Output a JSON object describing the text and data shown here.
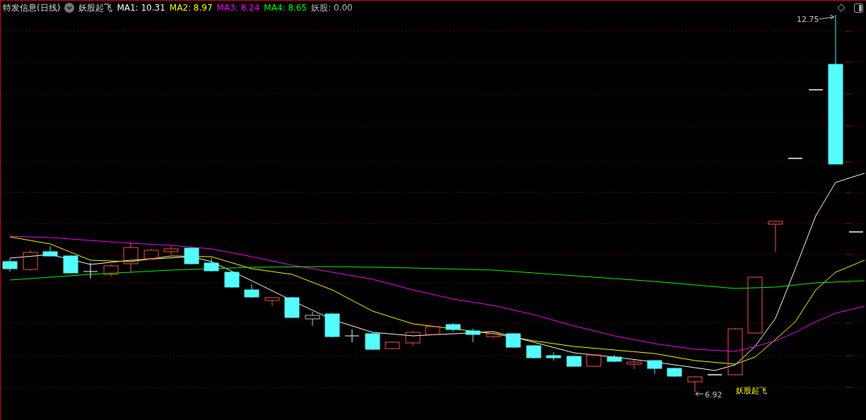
{
  "header": {
    "title": "特发信息(日线)",
    "indicator": "妖股起飞",
    "legend": [
      {
        "label": "MA1:",
        "value": "10.31",
        "color": "#ffffff"
      },
      {
        "label": "MA2:",
        "value": "8.97",
        "color": "#ffff00"
      },
      {
        "label": "MA3:",
        "value": "8.24",
        "color": "#ff00ff"
      },
      {
        "label": "MA4:",
        "value": "8.65",
        "color": "#00ff00"
      },
      {
        "label": "妖股:",
        "value": "0.00",
        "color": "#c0c0c0"
      }
    ]
  },
  "chart": {
    "high_label": "12.75",
    "low_label": "6.92",
    "signal_label": "妖股起飞"
  }
}
